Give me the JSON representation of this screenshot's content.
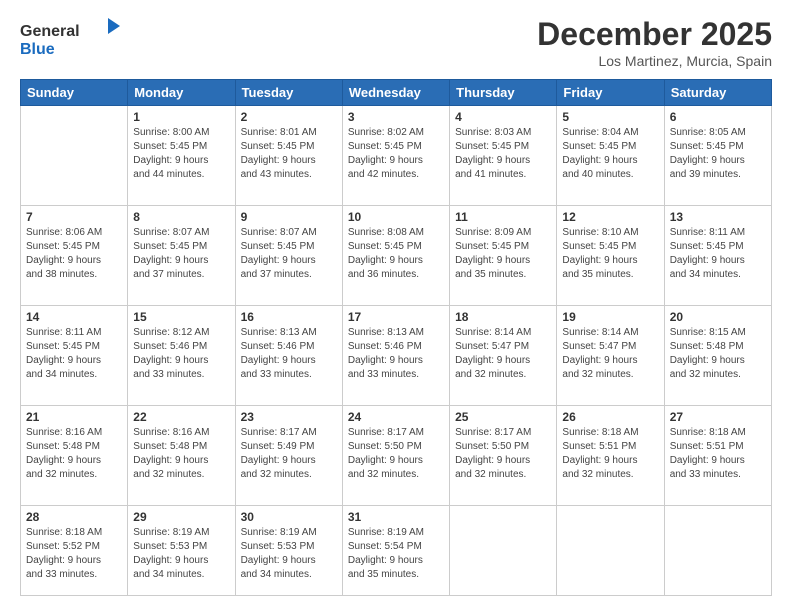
{
  "header": {
    "logo_line1": "General",
    "logo_line2": "Blue",
    "month": "December 2025",
    "location": "Los Martinez, Murcia, Spain"
  },
  "weekdays": [
    "Sunday",
    "Monday",
    "Tuesday",
    "Wednesday",
    "Thursday",
    "Friday",
    "Saturday"
  ],
  "weeks": [
    [
      {
        "day": "",
        "info": ""
      },
      {
        "day": "1",
        "info": "Sunrise: 8:00 AM\nSunset: 5:45 PM\nDaylight: 9 hours\nand 44 minutes."
      },
      {
        "day": "2",
        "info": "Sunrise: 8:01 AM\nSunset: 5:45 PM\nDaylight: 9 hours\nand 43 minutes."
      },
      {
        "day": "3",
        "info": "Sunrise: 8:02 AM\nSunset: 5:45 PM\nDaylight: 9 hours\nand 42 minutes."
      },
      {
        "day": "4",
        "info": "Sunrise: 8:03 AM\nSunset: 5:45 PM\nDaylight: 9 hours\nand 41 minutes."
      },
      {
        "day": "5",
        "info": "Sunrise: 8:04 AM\nSunset: 5:45 PM\nDaylight: 9 hours\nand 40 minutes."
      },
      {
        "day": "6",
        "info": "Sunrise: 8:05 AM\nSunset: 5:45 PM\nDaylight: 9 hours\nand 39 minutes."
      }
    ],
    [
      {
        "day": "7",
        "info": "Sunrise: 8:06 AM\nSunset: 5:45 PM\nDaylight: 9 hours\nand 38 minutes."
      },
      {
        "day": "8",
        "info": "Sunrise: 8:07 AM\nSunset: 5:45 PM\nDaylight: 9 hours\nand 37 minutes."
      },
      {
        "day": "9",
        "info": "Sunrise: 8:07 AM\nSunset: 5:45 PM\nDaylight: 9 hours\nand 37 minutes."
      },
      {
        "day": "10",
        "info": "Sunrise: 8:08 AM\nSunset: 5:45 PM\nDaylight: 9 hours\nand 36 minutes."
      },
      {
        "day": "11",
        "info": "Sunrise: 8:09 AM\nSunset: 5:45 PM\nDaylight: 9 hours\nand 35 minutes."
      },
      {
        "day": "12",
        "info": "Sunrise: 8:10 AM\nSunset: 5:45 PM\nDaylight: 9 hours\nand 35 minutes."
      },
      {
        "day": "13",
        "info": "Sunrise: 8:11 AM\nSunset: 5:45 PM\nDaylight: 9 hours\nand 34 minutes."
      }
    ],
    [
      {
        "day": "14",
        "info": "Sunrise: 8:11 AM\nSunset: 5:45 PM\nDaylight: 9 hours\nand 34 minutes."
      },
      {
        "day": "15",
        "info": "Sunrise: 8:12 AM\nSunset: 5:46 PM\nDaylight: 9 hours\nand 33 minutes."
      },
      {
        "day": "16",
        "info": "Sunrise: 8:13 AM\nSunset: 5:46 PM\nDaylight: 9 hours\nand 33 minutes."
      },
      {
        "day": "17",
        "info": "Sunrise: 8:13 AM\nSunset: 5:46 PM\nDaylight: 9 hours\nand 33 minutes."
      },
      {
        "day": "18",
        "info": "Sunrise: 8:14 AM\nSunset: 5:47 PM\nDaylight: 9 hours\nand 32 minutes."
      },
      {
        "day": "19",
        "info": "Sunrise: 8:14 AM\nSunset: 5:47 PM\nDaylight: 9 hours\nand 32 minutes."
      },
      {
        "day": "20",
        "info": "Sunrise: 8:15 AM\nSunset: 5:48 PM\nDaylight: 9 hours\nand 32 minutes."
      }
    ],
    [
      {
        "day": "21",
        "info": "Sunrise: 8:16 AM\nSunset: 5:48 PM\nDaylight: 9 hours\nand 32 minutes."
      },
      {
        "day": "22",
        "info": "Sunrise: 8:16 AM\nSunset: 5:48 PM\nDaylight: 9 hours\nand 32 minutes."
      },
      {
        "day": "23",
        "info": "Sunrise: 8:17 AM\nSunset: 5:49 PM\nDaylight: 9 hours\nand 32 minutes."
      },
      {
        "day": "24",
        "info": "Sunrise: 8:17 AM\nSunset: 5:50 PM\nDaylight: 9 hours\nand 32 minutes."
      },
      {
        "day": "25",
        "info": "Sunrise: 8:17 AM\nSunset: 5:50 PM\nDaylight: 9 hours\nand 32 minutes."
      },
      {
        "day": "26",
        "info": "Sunrise: 8:18 AM\nSunset: 5:51 PM\nDaylight: 9 hours\nand 32 minutes."
      },
      {
        "day": "27",
        "info": "Sunrise: 8:18 AM\nSunset: 5:51 PM\nDaylight: 9 hours\nand 33 minutes."
      }
    ],
    [
      {
        "day": "28",
        "info": "Sunrise: 8:18 AM\nSunset: 5:52 PM\nDaylight: 9 hours\nand 33 minutes."
      },
      {
        "day": "29",
        "info": "Sunrise: 8:19 AM\nSunset: 5:53 PM\nDaylight: 9 hours\nand 34 minutes."
      },
      {
        "day": "30",
        "info": "Sunrise: 8:19 AM\nSunset: 5:53 PM\nDaylight: 9 hours\nand 34 minutes."
      },
      {
        "day": "31",
        "info": "Sunrise: 8:19 AM\nSunset: 5:54 PM\nDaylight: 9 hours\nand 35 minutes."
      },
      {
        "day": "",
        "info": ""
      },
      {
        "day": "",
        "info": ""
      },
      {
        "day": "",
        "info": ""
      }
    ]
  ]
}
